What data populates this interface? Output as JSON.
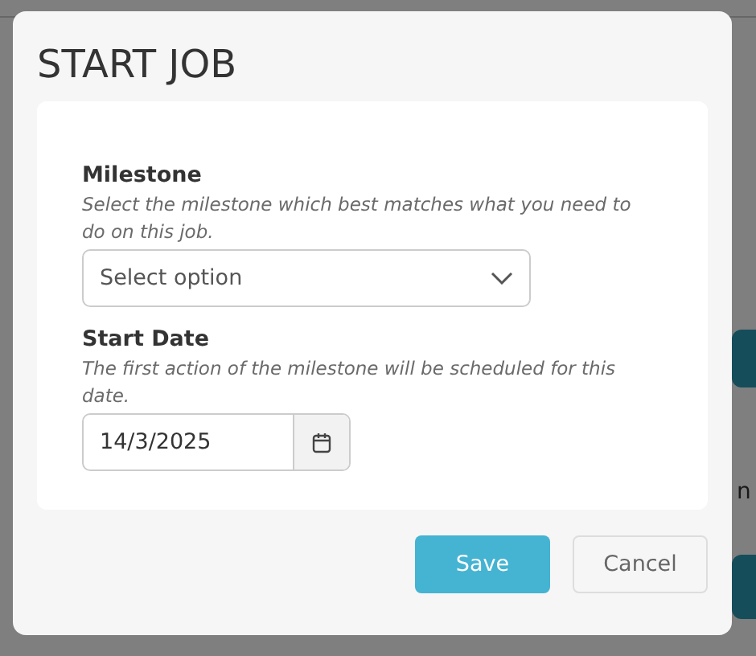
{
  "background_page": {
    "side_text": "n"
  },
  "dialog": {
    "title": "START JOB",
    "fields": [
      {
        "kind": "select",
        "label": "Milestone",
        "description": "Select the milestone which best matches what you need to do on this job.",
        "placeholder": "Select option"
      },
      {
        "kind": "date",
        "label": "Start Date",
        "description": "The first action of the milestone will be scheduled for this date.",
        "value": "14/3/2025"
      }
    ],
    "buttons": [
      {
        "label": "Save",
        "kind": "primary"
      },
      {
        "label": "Cancel",
        "kind": "secondary"
      }
    ]
  }
}
